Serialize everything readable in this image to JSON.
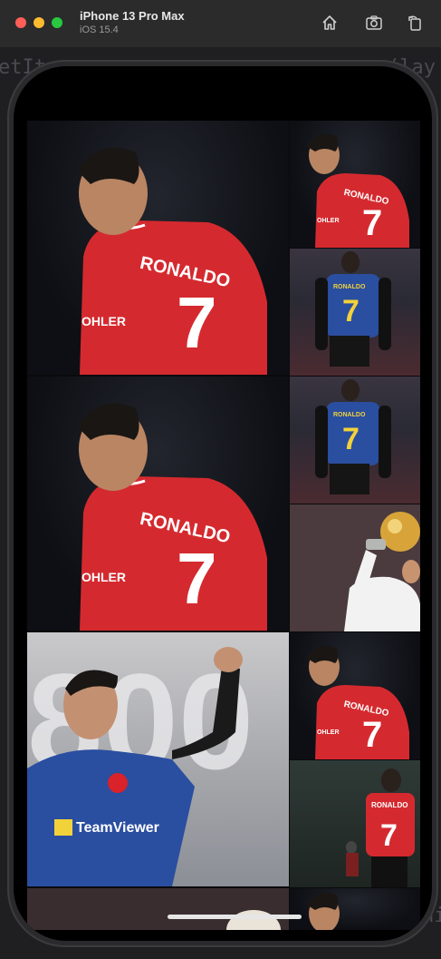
{
  "window": {
    "device_name": "iPhone 13 Pro Max",
    "os_version": "iOS 15.4",
    "toolbar": [
      "home-icon",
      "screenshot-icon",
      "rotate-icon"
    ]
  },
  "background_code": {
    "top_fragment": "etIte",
    "top_right_fragment": "(lay",
    "right_fragment": "hi"
  },
  "gallery": {
    "tiles": [
      {
        "type": "big",
        "subject": "red-jersey-back",
        "jersey_name": "RONALDO",
        "jersey_number": "7",
        "sponsor": "OHLER"
      },
      {
        "type": "small",
        "subject": "red-jersey-back",
        "jersey_name": "RONALDO",
        "jersey_number": "7",
        "sponsor": "OHLER"
      },
      {
        "type": "small",
        "subject": "blue-jersey-back",
        "jersey_name": "RONALDO",
        "jersey_number": "7"
      },
      {
        "type": "big",
        "subject": "red-jersey-back",
        "jersey_name": "RONALDO",
        "jersey_number": "7",
        "sponsor": "OHLER"
      },
      {
        "type": "small",
        "subject": "blue-jersey-back",
        "jersey_name": "RONALDO",
        "jersey_number": "7"
      },
      {
        "type": "small",
        "subject": "ballon-dor-trophy"
      },
      {
        "type": "big",
        "subject": "fist-celebration",
        "sponsor": "TeamViewer",
        "backdrop": "800"
      },
      {
        "type": "small",
        "subject": "red-jersey-back",
        "jersey_name": "RONALDO",
        "jersey_number": "7",
        "sponsor": "OHLER"
      },
      {
        "type": "small",
        "subject": "red-jersey-stadium",
        "jersey_name": "RONALDO",
        "jersey_number": "7"
      }
    ]
  },
  "colors": {
    "united_red": "#d9222a",
    "united_blue": "#2a4ea0",
    "jersey_yellow": "#f2d23a"
  }
}
